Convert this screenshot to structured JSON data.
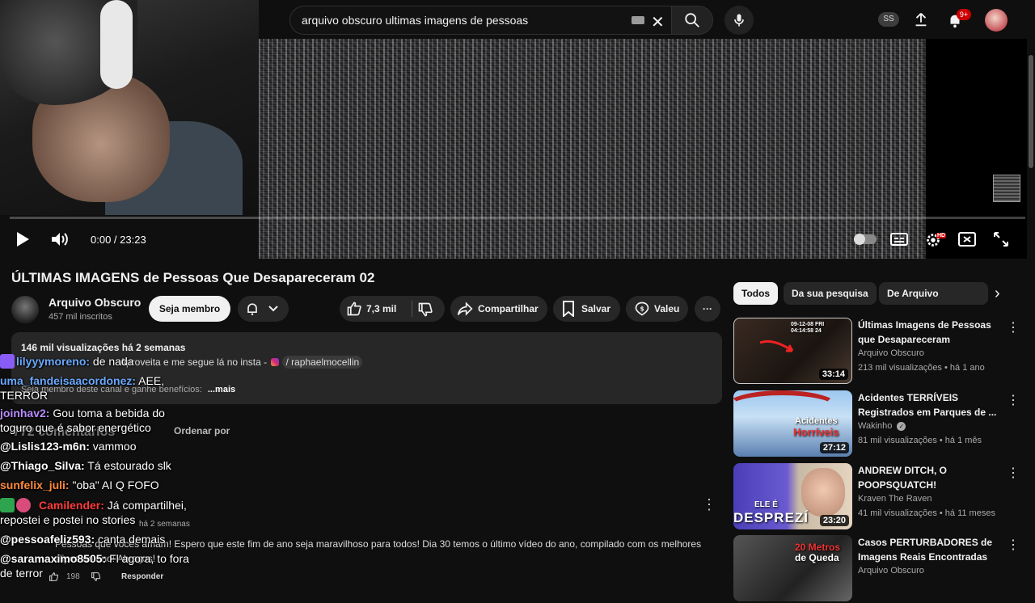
{
  "search": {
    "query": "arquivo obscuro ultimas imagens de pessoas"
  },
  "header": {
    "account_badge": "SS",
    "notifications_badge": "9+"
  },
  "player": {
    "time": "0:00 / 23:23",
    "progress": 0.0,
    "hd_badge": "HD"
  },
  "video": {
    "title": "ÚLTIMAS IMAGENS de Pessoas Que Desapareceram 02",
    "channel": "Arquivo Obscuro",
    "subscribers": "457 mil inscritos",
    "join_label": "Seja membro",
    "likes": "7,3 mil",
    "share_label": "Compartilhar",
    "save_label": "Salvar",
    "thanks_label": "Valeu",
    "more_label": "···"
  },
  "description": {
    "stats": "146 mil visualizações  há 2 semanas",
    "line1_prefix": "Aproveita e me segue lá no insta - ",
    "line1_handle": "/ raphaelmocellin",
    "line2": "Seja membro deste canal e ganhe benefícios:",
    "more": "...mais"
  },
  "comments": {
    "count": "772 comentários",
    "sort": "Ordenar por",
    "age": "há 2 semanas",
    "text": "Pessoas que vocês amam! Espero que este fim de ano seja maravilhoso para todos! Dia 30 temos o último vídeo do ano, compilado com os melhores clipes do ano! Abraços!",
    "likes": "198",
    "reply": "Responder"
  },
  "chat": [
    {
      "name": "lilyyymoreno:",
      "message": " de nada",
      "color": "#6aa8ff"
    },
    {
      "name": "uma_fandeisaacordonez:",
      "message": " AEE,",
      "message2": "TERROR",
      "color": "#6aa8ff"
    },
    {
      "name": "joinhav2:",
      "message": " Gou toma a bebida do",
      "message2": "toguro que é sabor energético",
      "color": "#b98cff"
    },
    {
      "name": "@Lislis123-m6n:",
      "message": " vammoo",
      "color": "#ffffff"
    },
    {
      "name": "@Thiago_Silva:",
      "message": " Tá estourado slk",
      "color": "#ffffff"
    },
    {
      "name": "sunfelix_juli:",
      "message": " \"oba\" AI Q FOFO",
      "color": "#ff8a3d"
    },
    {
      "name": "Camilender:",
      "message": " Já compartilhei,",
      "message2": "repostei e postei no stories",
      "color": "#ff3b3b"
    },
    {
      "name": "@pessoafeliz593:",
      "message": " canta demais",
      "color": "#ffffff"
    },
    {
      "name": "@saramaximo8505:",
      "message": " Fl agora, to fora",
      "message2": "de terror",
      "color": "#ffffff"
    }
  ],
  "sidebar": {
    "chips": [
      "Todos",
      "Da sua pesquisa",
      "De Arquivo Obscuro"
    ],
    "recommendations": [
      {
        "title": "Últimas Imagens de Pessoas que Desapareceram",
        "channel": "Arquivo Obscuro",
        "meta": "213 mil visualizações • há 1 ano",
        "duration": "33:14",
        "thumb_text": "09-12-08 FRI 04:14:58 24"
      },
      {
        "title": "Acidentes TERRÍVEIS Registrados em Parques de ...",
        "channel": "Wakinho",
        "meta": "81 mil visualizações • há 1 mês",
        "duration": "27:12",
        "thumb_text": "Acidentes",
        "thumb_text2": "Horríveis"
      },
      {
        "title": "ANDREW DITCH, O POOPSQUATCH!",
        "channel": "Kraven The Raven",
        "meta": "41 mil visualizações • há 11 meses",
        "duration": "23:20",
        "thumb_text": "ELE É",
        "thumb_text2": "DESPREZÍ"
      },
      {
        "title": "Casos PERTURBADORES de Imagens Reais Encontradas",
        "channel": "Arquivo Obscuro",
        "meta": "",
        "duration": "",
        "thumb_text": "20 Metros",
        "thumb_text2": "de Queda"
      }
    ]
  }
}
